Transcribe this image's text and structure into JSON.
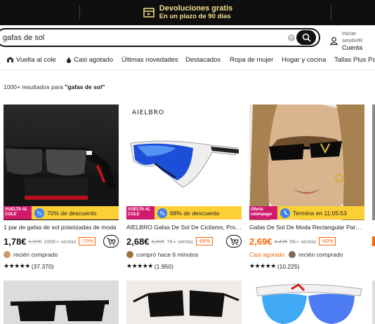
{
  "banner": {
    "line1": "Devoluciones gratis",
    "line2": "En un plazo de 90 días",
    "icon": "return-box-icon"
  },
  "search": {
    "value": "gafas de sol",
    "button_icon": "search-icon"
  },
  "account": {
    "line1": "Iniciar sesión/R",
    "line2": "Cuenta"
  },
  "nav": [
    {
      "label": "Vuelta al cole",
      "icon": "school-icon"
    },
    {
      "label": "Casi agotado",
      "icon": "drop-icon"
    },
    {
      "label": "Últimas novedades"
    },
    {
      "label": "Destacados"
    },
    {
      "label": "Ropa de mujer"
    },
    {
      "label": "Hogar y cocina"
    },
    {
      "label": "Tallas Plus Para"
    }
  ],
  "results": {
    "count_text": "1000+ resultados para ",
    "query": "\"gafas de sol\""
  },
  "products": [
    {
      "badge": "VUELTA AL COLE",
      "tag": "70% de descuento",
      "title": "1 par de gafas de sol polarizadas de moda",
      "price": "1,78€",
      "old_price": "5,99€",
      "sold": "100K+ ventas",
      "discount": "-70%",
      "social": "recién comprado",
      "low_stock": "",
      "stars": "★★★★★",
      "reviews": "(37.370)"
    },
    {
      "badge": "VUELTA AL COLE",
      "tag": "68% de descuento",
      "title": "AIELBRO Gafas De Sol De Ciclismo, Protección",
      "price": "2,68€",
      "old_price": "8,49€",
      "sold": "7K+ ventas",
      "discount": "-68%",
      "social": "compró hace 6 minutos",
      "low_stock": "",
      "stars": "★★★★★",
      "reviews": "(1.950)",
      "brand": "AIELBRO"
    },
    {
      "badge": "Oferta relámpago",
      "tag": "Termina en 11:05:53",
      "title": "Gafas De Sol De Moda Rectangular Para Mujer",
      "price": "2,69€",
      "old_price": "4,49€",
      "sold": "5K+ ventas",
      "discount": "-40%",
      "social": "recién comprado",
      "low_stock": "Casi agotado",
      "stars": "★★★★★",
      "reviews": "(10.225)"
    }
  ],
  "colors": {
    "accent": "#f76707",
    "banner_bg": "#0f0f0f",
    "banner_text": "#f3e08b",
    "tag_yellow": "#fcd034",
    "badge_pink": "#d11a6e"
  }
}
